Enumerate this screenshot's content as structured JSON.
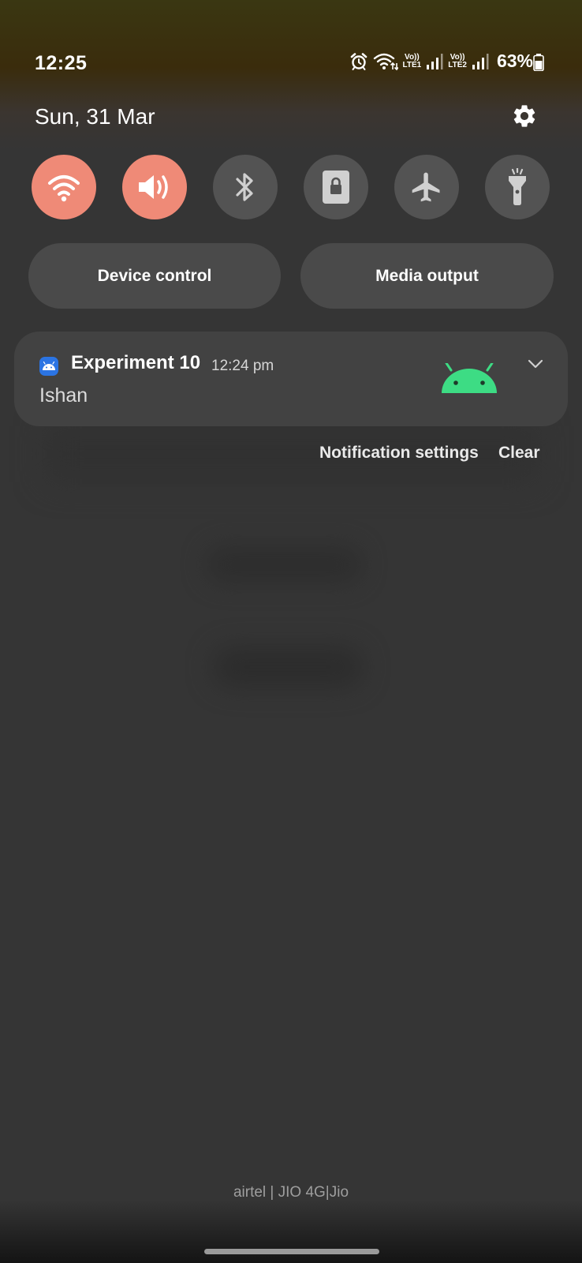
{
  "status_bar": {
    "time": "12:25",
    "sim1": {
      "top": "Vo))",
      "bottom": "LTE1"
    },
    "sim2": {
      "top": "Vo))",
      "bottom": "LTE2"
    },
    "battery": "63%",
    "icons": [
      "alarm-icon",
      "wifi-icon",
      "signal-icon",
      "battery-icon"
    ]
  },
  "header": {
    "date": "Sun, 31 Mar"
  },
  "quick_settings": [
    {
      "name": "wifi",
      "icon": "wifi-icon",
      "on": true
    },
    {
      "name": "sound",
      "icon": "volume-icon",
      "on": true
    },
    {
      "name": "bluetooth",
      "icon": "bluetooth-icon",
      "on": false
    },
    {
      "name": "rotation-lock",
      "icon": "portrait-lock-icon",
      "on": false
    },
    {
      "name": "airplane-mode",
      "icon": "airplane-icon",
      "on": false
    },
    {
      "name": "flashlight",
      "icon": "flashlight-icon",
      "on": false
    }
  ],
  "pills": {
    "device_control": "Device control",
    "media_output": "Media output"
  },
  "notification": {
    "app_name": "Experiment 10",
    "time": "12:24 pm",
    "text": "Ishan",
    "app_icon": "android-icon",
    "large_icon": "android-head-icon"
  },
  "actions": {
    "settings": "Notification settings",
    "clear": "Clear"
  },
  "carrier": "airtel | JIO 4G|Jio",
  "colors": {
    "toggle_on": "#ef8a77",
    "toggle_off": "#535353",
    "android_green": "#3ddc84",
    "app_icon_blue": "#2b74e3"
  }
}
